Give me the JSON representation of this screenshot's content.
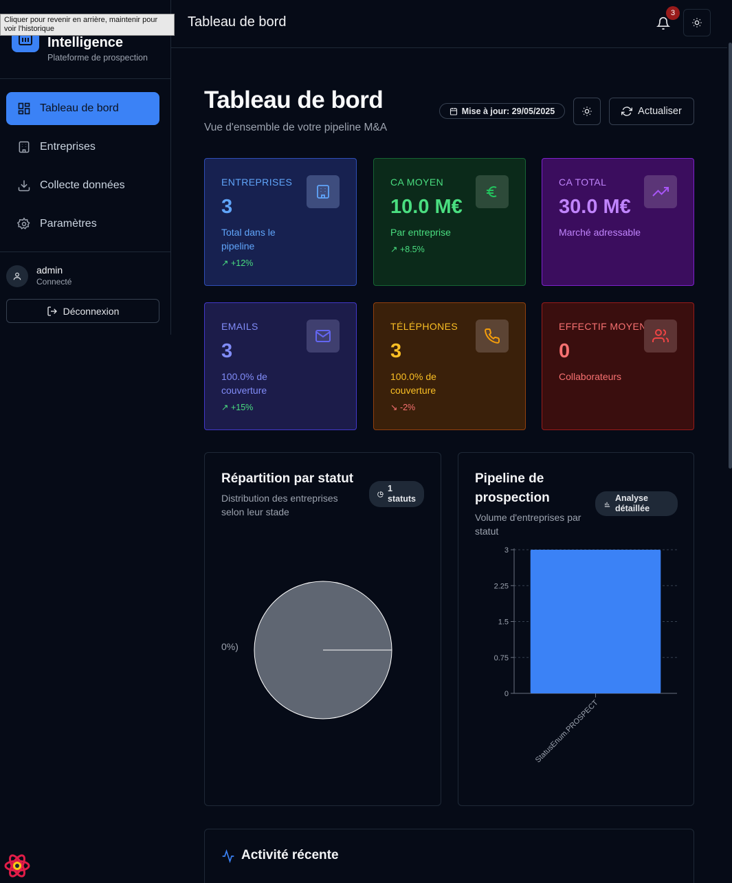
{
  "tooltip": "Cliquer pour revenir en arrière, maintenir pour voir l'historique",
  "brand": {
    "title": "Intelligence",
    "subtitle": "Plateforme de prospection"
  },
  "nav": {
    "items": [
      {
        "label": "Tableau de bord",
        "icon": "dashboard-icon",
        "active": true
      },
      {
        "label": "Entreprises",
        "icon": "building-icon",
        "active": false
      },
      {
        "label": "Collecte données",
        "icon": "download-icon",
        "active": false
      },
      {
        "label": "Paramètres",
        "icon": "gear-icon",
        "active": false
      }
    ]
  },
  "user": {
    "name": "admin",
    "status": "Connecté",
    "logout": "Déconnexion"
  },
  "topbar": {
    "title": "Tableau de bord",
    "notifications": "3"
  },
  "page": {
    "title": "Tableau de bord",
    "subtitle": "Vue d'ensemble de votre pipeline M&A",
    "update": "Mise à jour: 29/05/2025",
    "refresh": "Actualiser"
  },
  "cards": [
    {
      "label": "ENTREPRISES",
      "value": "3",
      "desc": "Total dans le pipeline",
      "trend": "↗ +12%",
      "icon": "building-icon"
    },
    {
      "label": "CA MOYEN",
      "value": "10.0 M€",
      "desc": "Par entreprise",
      "trend": "↗ +8.5%",
      "icon": "euro-icon"
    },
    {
      "label": "CA TOTAL",
      "value": "30.0 M€",
      "desc": "Marché adressable",
      "trend": "",
      "icon": "trending-up-icon"
    },
    {
      "label": "EMAILS",
      "value": "3",
      "desc": "100.0% de couverture",
      "trend": "↗ +15%",
      "icon": "mail-icon"
    },
    {
      "label": "TÉLÉPHONES",
      "value": "3",
      "desc": "100.0% de couverture",
      "trend": "↘ -2%",
      "icon": "phone-icon"
    },
    {
      "label": "EFFECTIF MOYEN",
      "value": "0",
      "desc": "Collaborateurs",
      "trend": "",
      "icon": "users-icon"
    }
  ],
  "status_panel": {
    "title": "Répartition par statut",
    "subtitle": "Distribution des entreprises selon leur stade",
    "pill": "1 statuts",
    "pie_label": "0%)"
  },
  "pipeline_panel": {
    "title": "Pipeline de prospection",
    "subtitle": "Volume d'entreprises par statut",
    "pill": "Analyse détaillée"
  },
  "activity": {
    "title": "Activité récente"
  },
  "chart_data": [
    {
      "type": "pie",
      "title": "Répartition par statut",
      "categories": [
        "StatusEnum.PROSPECT"
      ],
      "values": [
        3
      ],
      "colors": [
        "#5f6672"
      ]
    },
    {
      "type": "bar",
      "title": "Pipeline de prospection",
      "categories": [
        "StatusEnum.PROSPECT"
      ],
      "values": [
        3
      ],
      "yticks": [
        "0",
        "0.75",
        "1.5",
        "2.25",
        "3"
      ],
      "ylim": [
        0,
        3
      ],
      "grid": true,
      "color": "#3b82f6"
    }
  ]
}
